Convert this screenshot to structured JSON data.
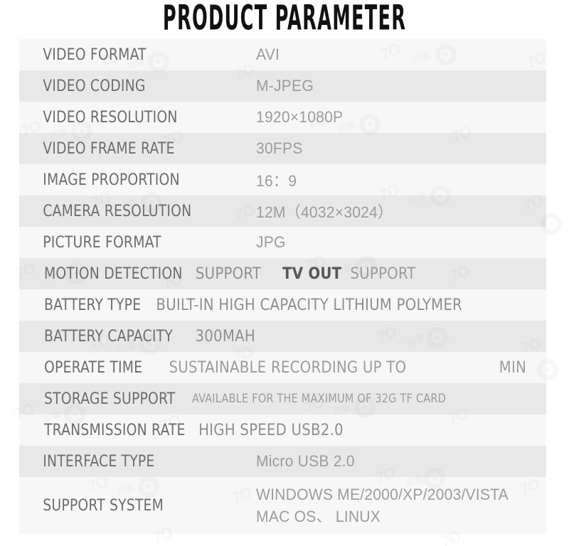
{
  "header": {
    "title": "PRODUCT PARAMETER"
  },
  "colors": {
    "row_light": "#f7f7f7",
    "row_dark": "#e8e8e8",
    "label_text": "#6d6d6d",
    "value_text": "#9c9c9c",
    "value_strong": "#575757",
    "title_text": "#111111",
    "page_background": "#ffffff"
  },
  "watermark": {
    "text": "7O",
    "cjk": "印象",
    "icon": "ring-target-icon"
  },
  "table": {
    "rows": [
      {
        "label": "VIDEO FORMAT",
        "value": "AVI"
      },
      {
        "label": "VIDEO CODING",
        "value": "M-JPEG"
      },
      {
        "label": "VIDEO RESOLUTION",
        "value": "1920×1080P"
      },
      {
        "label": "VIDEO FRAME RATE",
        "value": "30FPS"
      },
      {
        "label": "IMAGE PROPORTION",
        "value": "16：9"
      },
      {
        "label": "CAMERA RESOLUTION",
        "value": "12M（4032×3024）"
      },
      {
        "label": "PICTURE FORMAT",
        "value": "JPG"
      },
      {
        "label": "MOTION DETECTION",
        "value": "SUPPORT",
        "label2": "TV OUT",
        "value2": "SUPPORT"
      },
      {
        "label": "BATTERY TYPE",
        "value": "BUILT-IN HIGH CAPACITY LITHIUM POLYMER"
      },
      {
        "label": "BATTERY CAPACITY",
        "value": "300MAH"
      },
      {
        "label": "OPERATE TIME",
        "value": "SUSTAINABLE RECORDING UP TO",
        "value2": "MIN"
      },
      {
        "label": "STORAGE SUPPORT",
        "value": "AVAILABLE FOR THE MAXIMUM OF 32G TF CARD"
      },
      {
        "label": "TRANSMISSION RATE",
        "value": "HIGH SPEED USB2.0"
      },
      {
        "label": "INTERFACE TYPE",
        "value": "Micro USB 2.0"
      },
      {
        "label": "SUPPORT SYSTEM",
        "value": "WINDOWS ME/2000/XP/2003/VISTA",
        "value2": "MAC OS、 LINUX"
      }
    ]
  }
}
